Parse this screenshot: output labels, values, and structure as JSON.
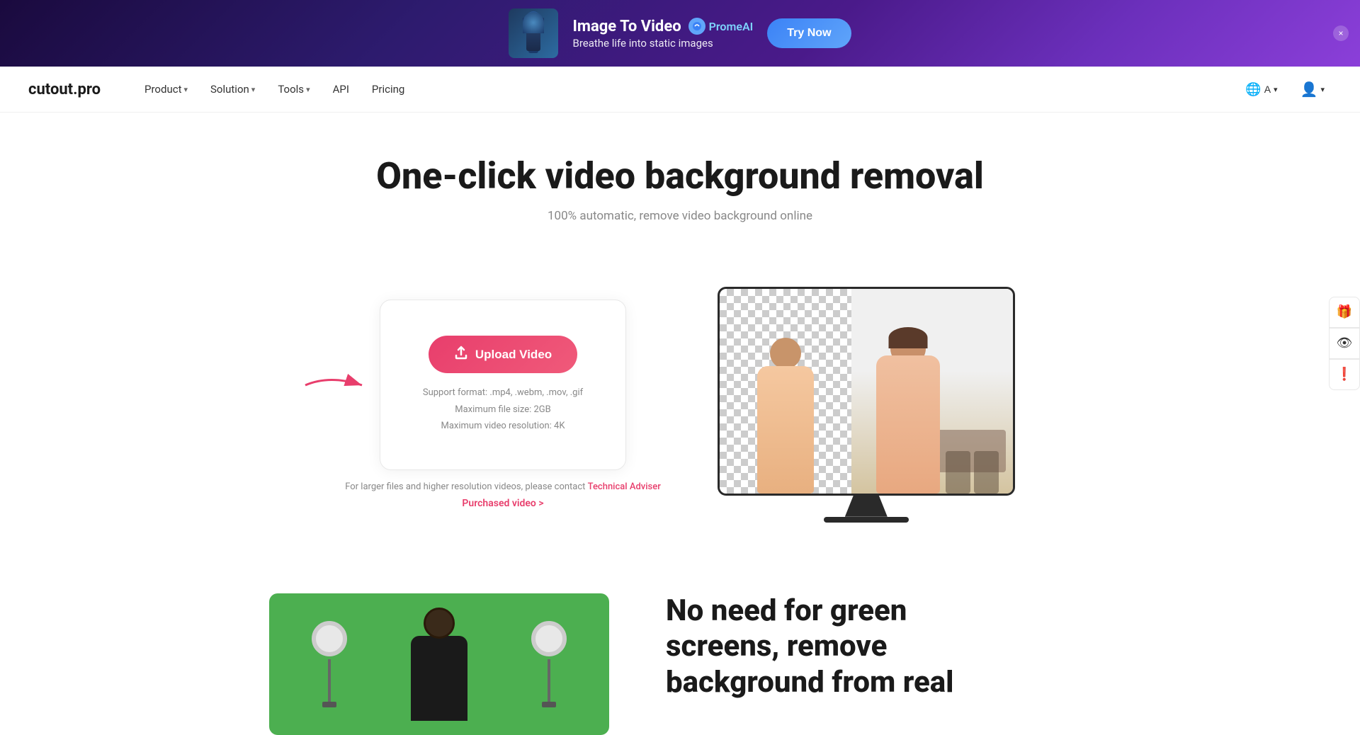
{
  "ad": {
    "title": "Image To Video",
    "subtitle": "Breathe life into static images",
    "brand": "PromeAI",
    "cta": "Try Now",
    "close_label": "×"
  },
  "nav": {
    "logo": "cutout.pro",
    "items": [
      {
        "label": "Product",
        "hasDropdown": true
      },
      {
        "label": "Solution",
        "hasDropdown": true
      },
      {
        "label": "Tools",
        "hasDropdown": true
      },
      {
        "label": "API",
        "hasDropdown": false
      },
      {
        "label": "Pricing",
        "hasDropdown": false
      }
    ],
    "lang_icon": "🌐",
    "lang_label": "A",
    "user_icon": "👤"
  },
  "hero": {
    "title": "One-click video background removal",
    "subtitle": "100% automatic, remove video background online"
  },
  "upload": {
    "button_label": "Upload Video",
    "format_text": "Support format: .mp4, .webm, .mov, .gif",
    "size_text": "Maximum file size: 2GB",
    "resolution_text": "Maximum video resolution: 4K",
    "contact_prefix": "For larger files and higher resolution videos, please contact ",
    "contact_link": "Technical Adviser",
    "purchased_label": "Purchased video >"
  },
  "section2": {
    "title_line1": "No need for green",
    "title_line2": "screens, remove",
    "title_line3": "background from real"
  },
  "sidebar": {
    "gift_icon": "🎁",
    "eye_icon": "👁",
    "alert_icon": "❗"
  }
}
